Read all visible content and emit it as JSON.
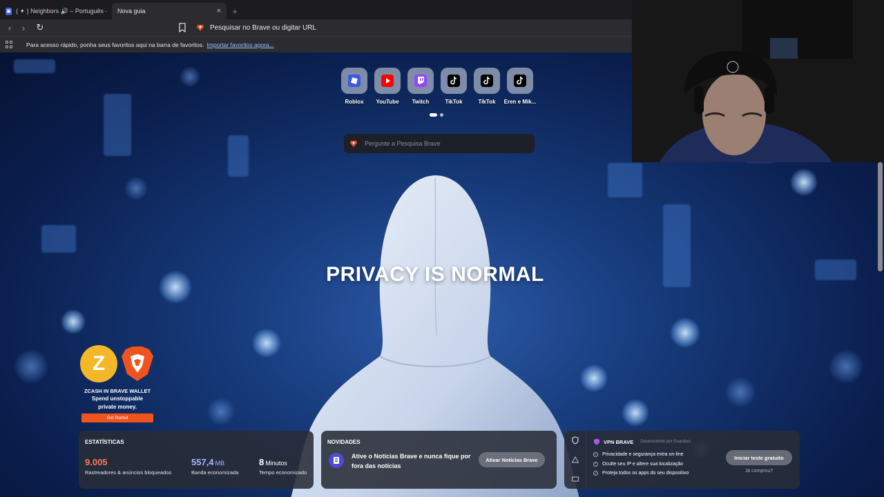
{
  "browser": {
    "tabs": [
      {
        "title": "( ✦ ) Neighbors 🔊 – Português - Rob...",
        "active": false,
        "icon": "roblox-icon"
      },
      {
        "title": "Nova guia",
        "active": true
      }
    ],
    "close_glyph": "×",
    "newtab_glyph": "+",
    "back_glyph": "‹",
    "forward_glyph": "›",
    "reload_glyph": "↻",
    "url_placeholder": "Pesquisar no Brave ou digitar URL"
  },
  "bookmarks_bar": {
    "text": "Para acesso rápido, ponha seus favoritos aqui na barra de favoritos.",
    "link": "Importar favoritos agora..."
  },
  "top_sites": [
    {
      "label": "Roblox",
      "icon": "roblox-icon",
      "color": "#3b5bdb"
    },
    {
      "label": "YouTube",
      "icon": "youtube-icon",
      "color": "#ff0000"
    },
    {
      "label": "Twitch",
      "icon": "twitch-icon",
      "color": "#9146ff"
    },
    {
      "label": "TikTok",
      "icon": "tiktok-icon",
      "color": "#000000"
    },
    {
      "label": "TikTok",
      "icon": "tiktok-icon",
      "color": "#000000"
    },
    {
      "label": "Eren e Mik...",
      "icon": "tiktok-icon",
      "color": "#000000"
    }
  ],
  "search": {
    "placeholder": "Pergunte a Pesquisa Brave"
  },
  "headline": "PRIVACY IS NORMAL",
  "promo": {
    "logo_glyph": "Z",
    "title": "ZCASH IN BRAVE WALLET",
    "line1": "Spend unstoppable",
    "line2": "private money.",
    "button": "Get Started",
    "button_color": "#f0541e"
  },
  "stats": {
    "heading": "ESTATÍSTICAS",
    "trackers": {
      "value": "9.005",
      "label": "Rastreadores & anúncios bloqueados",
      "color": "#ff7a59"
    },
    "bandwidth": {
      "value": "557,4",
      "unit": "MB",
      "label": "Banda economizada",
      "color": "#a8b4ff"
    },
    "time": {
      "value": "8",
      "unit": "Minutos",
      "label": "Tempo economizado",
      "color": "#ffffff"
    }
  },
  "news": {
    "heading": "NOVIDADES",
    "text": "Ative o Notícias Brave e nunca fique por fora das notícias",
    "button": "Ativar Notícias Brave"
  },
  "vpn": {
    "title": "VPN BRAVE",
    "subtitle": "Desenvolvido por Guardian",
    "items": [
      "Privacidade e segurança extra on-line",
      "Oculte seu IP e altere sua localização",
      "Proteja todos os apps do seu dispositivo"
    ],
    "button": "Iniciar teste gratuito",
    "link": "Já comprou?"
  }
}
